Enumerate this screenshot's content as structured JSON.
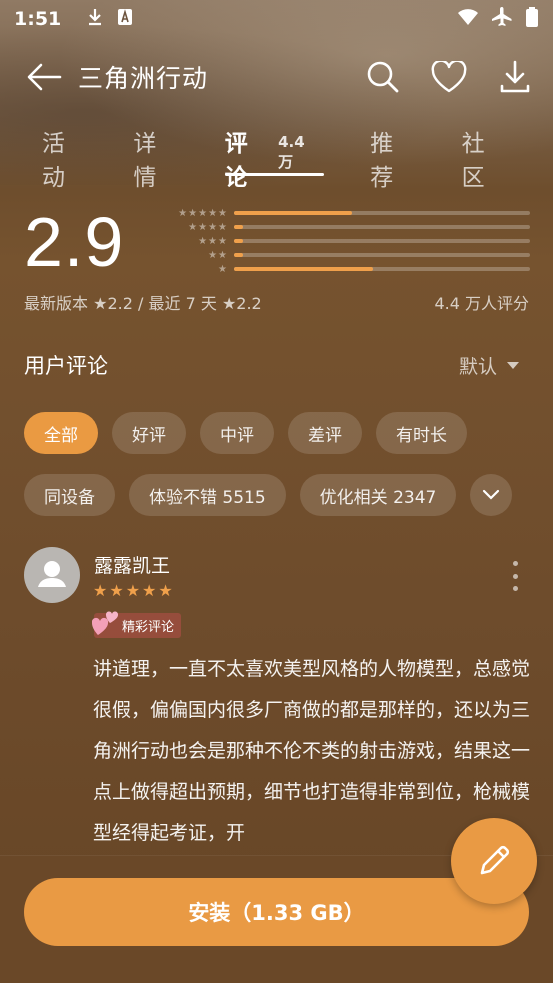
{
  "status_bar": {
    "time": "1:51"
  },
  "header": {
    "title": "三角洲行动"
  },
  "tabs": [
    {
      "label": "活动",
      "active": false
    },
    {
      "label": "详情",
      "active": false
    },
    {
      "label": "评论",
      "count": "4.4 万",
      "active": true
    },
    {
      "label": "推荐",
      "active": false
    },
    {
      "label": "社区",
      "active": false
    }
  ],
  "rating": {
    "score": "2.9",
    "distribution": [
      {
        "stars": 5,
        "fraction": 0.4
      },
      {
        "stars": 4,
        "fraction": 0.03
      },
      {
        "stars": 3,
        "fraction": 0.03
      },
      {
        "stars": 2,
        "fraction": 0.03
      },
      {
        "stars": 1,
        "fraction": 0.47
      }
    ],
    "latest_version_label": "最新版本",
    "latest_version_score": "2.2",
    "recent_label": "最近 7 天",
    "recent_score": "2.2",
    "rating_count": "4.4 万人评分",
    "accent_color": "#f0a04b"
  },
  "reviews": {
    "title": "用户评论",
    "sort_label": "默认",
    "filters_row1": [
      "全部",
      "好评",
      "中评",
      "差评",
      "有时长"
    ],
    "filters_row2": [
      "同设备",
      "体验不错 5515",
      "优化相关 2347"
    ],
    "active_filter": "全部"
  },
  "review": {
    "username": "露露凯王",
    "stars": 5,
    "badge": "精彩评论",
    "text": "讲道理，一直不太喜欢美型风格的人物模型，总感觉很假，偏偏国内很多厂商做的都是那样的，还以为三角洲行动也会是那种不伦不类的射击游戏，结果这一点上做得超出预期，细节也打造得非常到位，枪械模型经得起考证，开"
  },
  "install_button": {
    "label": "安装（1.33 GB）",
    "color": "#e99a44"
  },
  "icons": {
    "back": "arrow-left-icon",
    "search": "search-icon",
    "favorite": "heart-icon",
    "download": "download-icon",
    "write": "pencil-icon",
    "expand": "chevron-down-icon"
  }
}
